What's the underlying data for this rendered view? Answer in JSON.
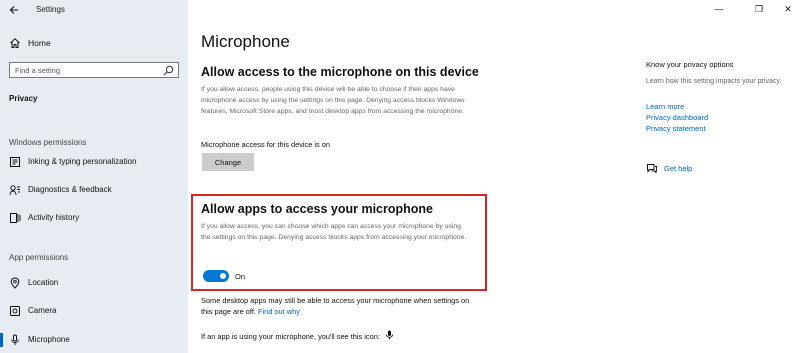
{
  "window": {
    "app_title": "Settings",
    "minimize": "—",
    "maximize": "❐",
    "close": "✕"
  },
  "sidebar": {
    "home_label": "Home",
    "search_placeholder": "Find a setting",
    "section_title": "Privacy",
    "group_windows": "Windows permissions",
    "group_app": "App permissions",
    "items": [
      {
        "label": "Inking & typing personalization",
        "icon": "inking-icon"
      },
      {
        "label": "Diagnostics & feedback",
        "icon": "diagnostics-icon"
      },
      {
        "label": "Activity history",
        "icon": "activity-history-icon"
      },
      {
        "label": "Location",
        "icon": "location-icon"
      },
      {
        "label": "Camera",
        "icon": "camera-icon"
      },
      {
        "label": "Microphone",
        "icon": "microphone-icon",
        "selected": true
      }
    ]
  },
  "main": {
    "title": "Microphone",
    "device_heading": "Allow access to the microphone on this device",
    "device_desc": "If you allow access, people using this device will be able to choose if their apps have microphone access by using the settings on this page. Denying access blocks Windows features, Microsoft Store apps, and most desktop apps from accessing the microphone.",
    "device_status": "Microphone access for this device is on",
    "change_button": "Change",
    "apps_heading": "Allow apps to access your microphone",
    "apps_desc": "If you allow access, you can choose which apps can access your microphone by using the settings on this page. Denying access blocks apps from accessing your microphone.",
    "toggle_state": "On",
    "toggle_on": true,
    "desktop_note": "Some desktop apps may still be able to access your microphone when settings on this page are off.",
    "find_out_why": "Find out why",
    "icon_note": "If an app is using your microphone, you'll see this icon:"
  },
  "right": {
    "title": "Know your privacy options",
    "desc": "Learn how this setting impacts your privacy.",
    "links": [
      "Learn more",
      "Privacy dashboard",
      "Privacy statement"
    ],
    "help": "Get help"
  },
  "colors": {
    "accent": "#0078d4",
    "link": "#0067c0",
    "highlight": "#d42828",
    "sidebar_bg": "#e6ecf2"
  }
}
